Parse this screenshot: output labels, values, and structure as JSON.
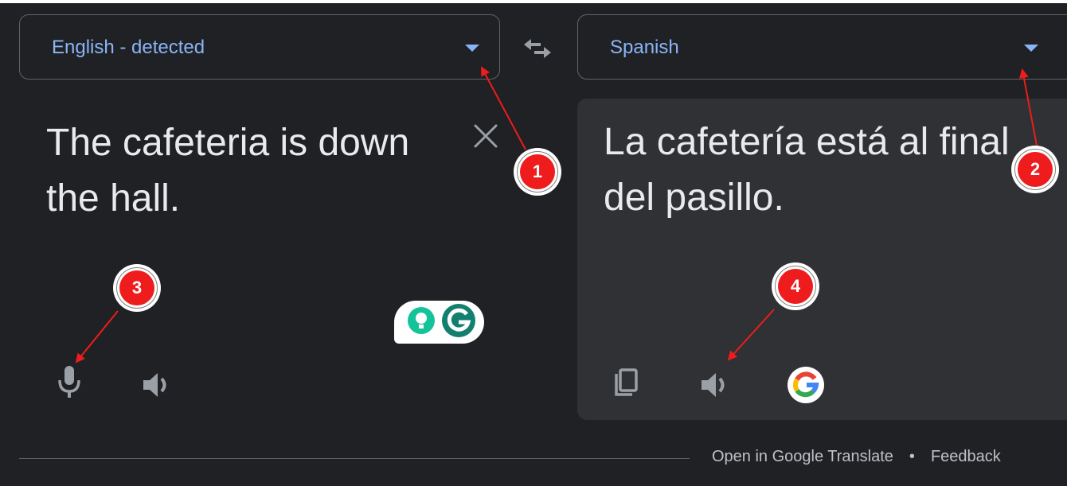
{
  "source": {
    "language_label": "English - detected",
    "text": "The cafeteria is down the hall."
  },
  "target": {
    "language_label": "Spanish",
    "text": "La cafetería está al final del pasillo."
  },
  "icons": {
    "swap": "swap-languages-icon",
    "clear": "close-icon",
    "mic": "microphone-icon",
    "speaker": "speaker-icon",
    "copy": "copy-icon",
    "google": "google-logo-icon",
    "grammarly": "grammarly-widget-icon"
  },
  "footer": {
    "open_link": "Open in Google Translate",
    "separator": "•",
    "feedback_link": "Feedback"
  },
  "annotations": [
    "1",
    "2",
    "3",
    "4"
  ],
  "colors": {
    "background": "#202124",
    "panel": "#303134",
    "accent": "#8ab4f8",
    "text": "#e8eaed",
    "icon": "#9aa0a6",
    "annotation": "#ee1c1c"
  }
}
